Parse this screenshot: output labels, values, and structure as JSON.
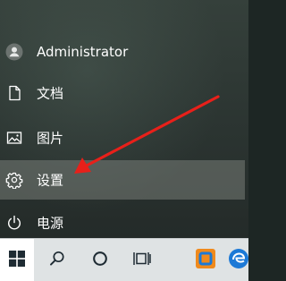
{
  "start_menu": {
    "user": {
      "name": "Administrator",
      "icon": "user-avatar-icon"
    },
    "items": [
      {
        "label": "文档",
        "icon": "document-icon"
      },
      {
        "label": "图片",
        "icon": "pictures-icon"
      },
      {
        "label": "设置",
        "icon": "gear-icon",
        "highlighted": true
      },
      {
        "label": "电源",
        "icon": "power-icon"
      }
    ]
  },
  "taskbar": {
    "buttons": [
      {
        "name": "start-button",
        "icon": "windows-logo-icon"
      },
      {
        "name": "search-button",
        "icon": "search-icon"
      },
      {
        "name": "cortana-button",
        "icon": "cortana-circle-icon"
      },
      {
        "name": "task-view-button",
        "icon": "task-view-icon"
      },
      {
        "name": "pinned-app-button",
        "icon": "orange-blue-app-icon"
      },
      {
        "name": "edge-button",
        "icon": "edge-browser-icon"
      }
    ]
  },
  "colors": {
    "panel_bg": "#2b3431",
    "highlight": "#7a7e78",
    "taskbar_bg": "#dfe3e4",
    "arrow": "#e8201a",
    "accent_orange": "#f08a1c",
    "accent_blue": "#1c79d6"
  }
}
